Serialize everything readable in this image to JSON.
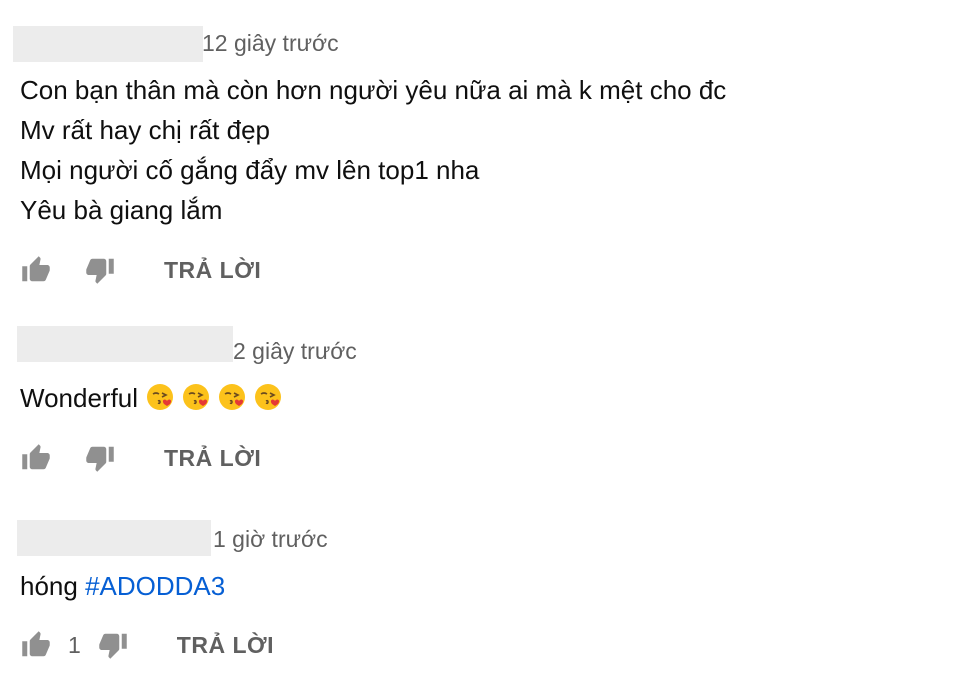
{
  "colors": {
    "text": "#0f0f0f",
    "secondary": "#606060",
    "link": "#065fd4",
    "redaction": "#ececec"
  },
  "icons": {
    "like": "thumbs-up-icon",
    "dislike": "thumbs-down-icon",
    "emoji": "face-blowing-a-kiss-emoji"
  },
  "comments": [
    {
      "timestamp": "12 giây trước",
      "lines": [
        "Con bạn thân mà còn hơn người yêu nữa ai mà k mệt cho đc",
        "Mv rất hay chị rất đẹp",
        "Mọi người cố gắng đẩy mv lên top1 nha",
        "Yêu bà giang lắm"
      ],
      "reply_label": "TRẢ LỜI"
    },
    {
      "timestamp": "2 giây trước",
      "text": "Wonderful",
      "emoji_count": 4,
      "reply_label": "TRẢ LỜI"
    },
    {
      "timestamp": "1 giờ trước",
      "text": "hóng",
      "hashtag": "#ADODDA3",
      "like_count": "1",
      "reply_label": "TRẢ LỜI"
    }
  ]
}
